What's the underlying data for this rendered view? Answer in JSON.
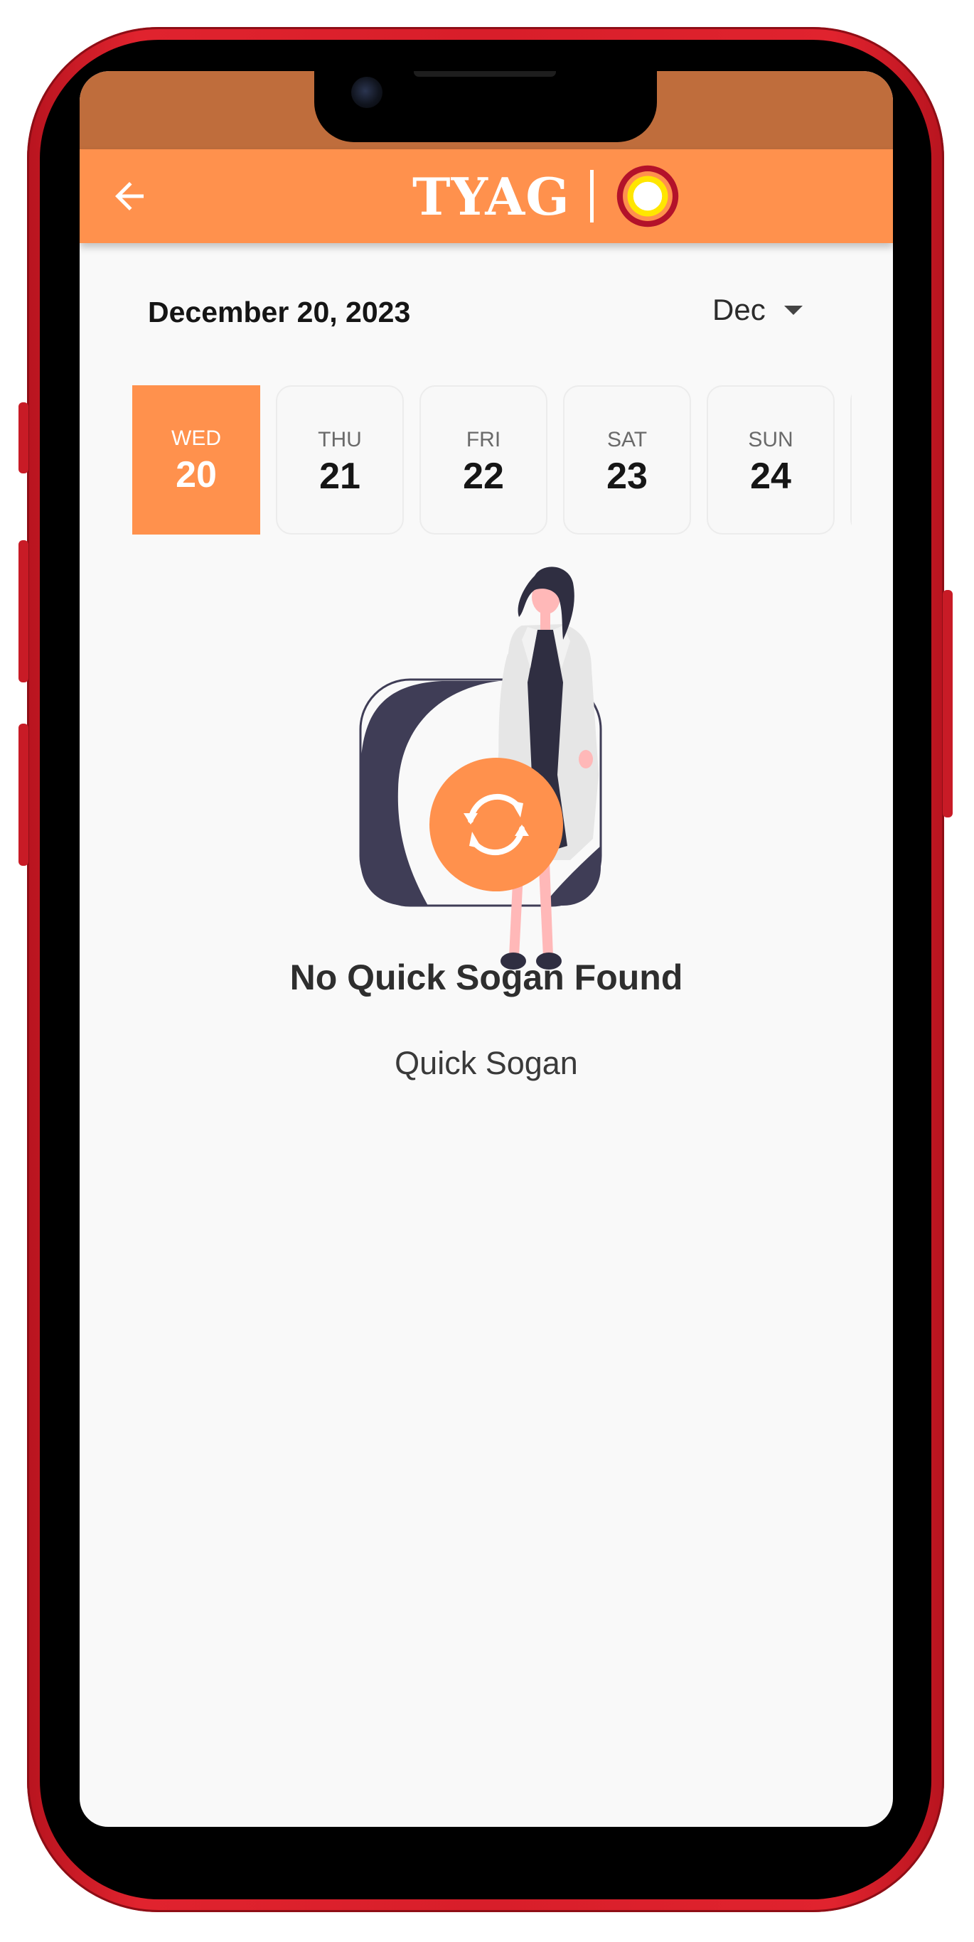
{
  "app_bar": {
    "brand_name": "TYAG",
    "back_icon": "arrow-left-icon",
    "logo_icon": "sun-ring-logo",
    "background_color": "#ff914d",
    "status_area_color": "#bf6d3c"
  },
  "date_header": {
    "selected_date": "December 20, 2023",
    "month_selector": "Dec",
    "month_caret_icon": "caret-down-icon"
  },
  "day_strip": {
    "selected_index": 0,
    "days": [
      {
        "weekday": "WED",
        "day": "20"
      },
      {
        "weekday": "THU",
        "day": "21"
      },
      {
        "weekday": "FRI",
        "day": "22"
      },
      {
        "weekday": "SAT",
        "day": "23"
      },
      {
        "weekday": "SUN",
        "day": "24"
      }
    ]
  },
  "empty_state": {
    "illustration": "woman-standing-illustration",
    "refresh_icon": "refresh-icon",
    "title": "No Quick Sogan Found",
    "subtitle": "Quick Sogan"
  },
  "device": {
    "frame_color": "#d81e2a"
  }
}
